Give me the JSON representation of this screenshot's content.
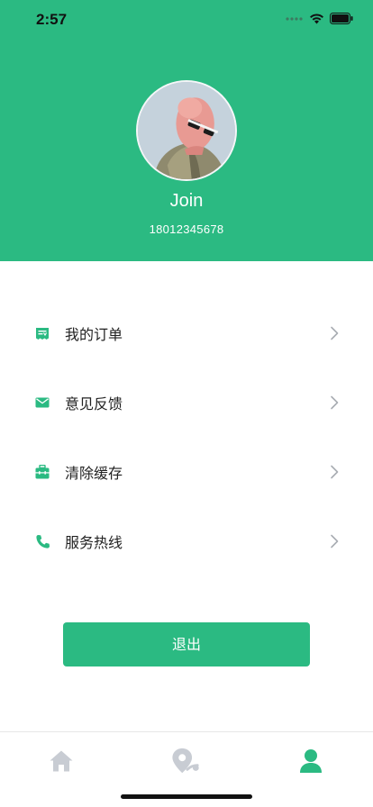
{
  "status_bar": {
    "time": "2:57"
  },
  "profile": {
    "name": "Join",
    "phone": "18012345678"
  },
  "menu": {
    "items": [
      {
        "label": "我的订单",
        "icon": "order-icon"
      },
      {
        "label": "意见反馈",
        "icon": "mail-icon"
      },
      {
        "label": "清除缓存",
        "icon": "briefcase-icon"
      },
      {
        "label": "服务热线",
        "icon": "phone-icon"
      }
    ]
  },
  "logout_label": "退出",
  "tab_bar": {
    "tabs": [
      {
        "icon": "home-icon",
        "active": false
      },
      {
        "icon": "map-pin-icon",
        "active": false
      },
      {
        "icon": "user-icon",
        "active": true
      }
    ]
  },
  "colors": {
    "accent": "#2bba82",
    "inactive_icon": "#c8ccd3",
    "chevron": "#a9adb3"
  }
}
